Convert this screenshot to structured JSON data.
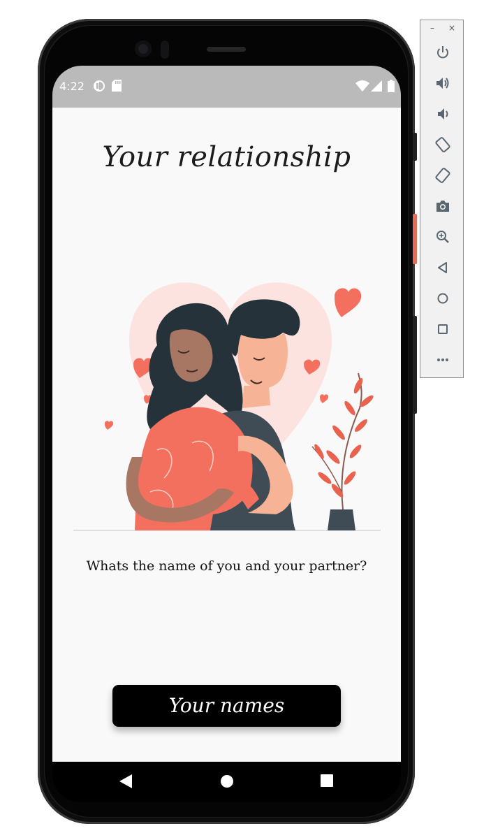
{
  "status_bar": {
    "time": "4:22",
    "icons": [
      "app-notification-icon",
      "sd-card-icon",
      "wifi-icon",
      "cellular-signal-icon",
      "battery-icon"
    ]
  },
  "screen": {
    "title": "Your relationship",
    "illustration": "couple-hugging-illustration",
    "question": "Whats the name of you and your partner?",
    "names_button_label": "Your names"
  },
  "nav_bar": {
    "buttons": [
      "back-icon",
      "home-icon",
      "recents-icon"
    ]
  },
  "emulator_toolbar": {
    "window_controls": {
      "minimize": "–",
      "close": "×"
    },
    "buttons": [
      "power-icon",
      "volume-up-icon",
      "volume-down-icon",
      "rotate-left-icon",
      "rotate-right-icon",
      "camera-icon",
      "zoom-icon",
      "back-icon",
      "home-icon",
      "overview-icon",
      "more-icon"
    ]
  },
  "colors": {
    "accent_coral": "#f4705e",
    "heart_pink": "#fde3e0",
    "dark_slate": "#3f4c55",
    "button_black": "#000000",
    "app_background": "#f9f9f9"
  }
}
